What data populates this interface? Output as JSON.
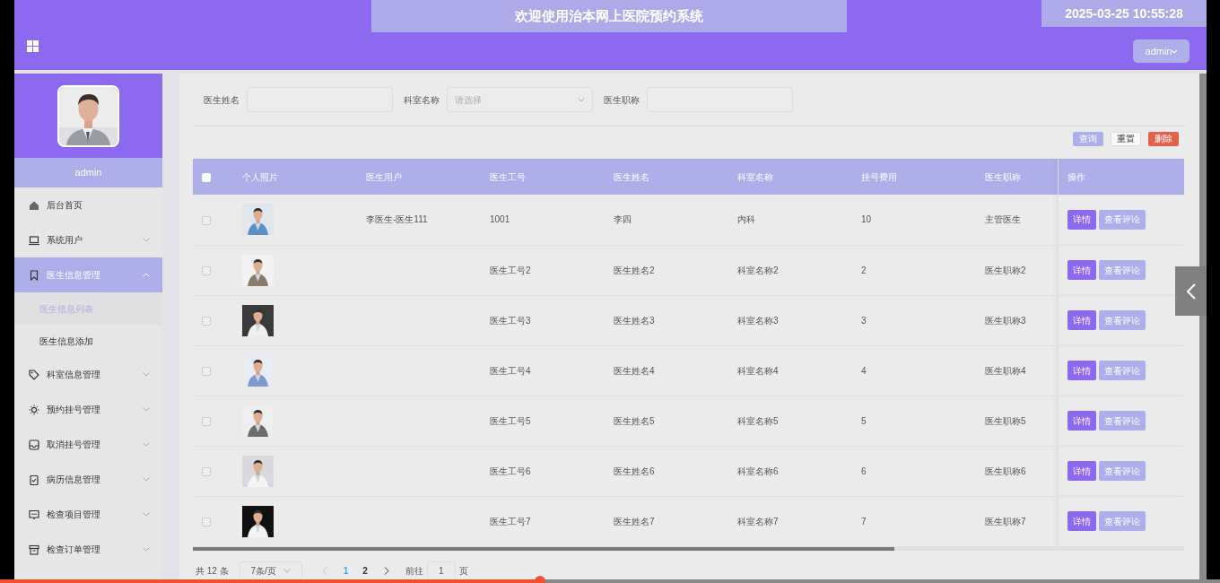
{
  "header": {
    "title": "欢迎使用治本网上医院预约系统",
    "clock": "2025-03-25 10:55:28",
    "user_button": "admin"
  },
  "sidebar": {
    "user_name": "admin",
    "items": [
      {
        "label": "后台首页",
        "expandable": false,
        "expanded": false
      },
      {
        "label": "系统用户",
        "expandable": true,
        "expanded": false
      },
      {
        "label": "医生信息管理",
        "expandable": true,
        "expanded": true,
        "children": [
          {
            "label": "医生信息列表",
            "selected": true
          },
          {
            "label": "医生信息添加",
            "selected": false
          }
        ]
      },
      {
        "label": "科室信息管理",
        "expandable": true,
        "expanded": false
      },
      {
        "label": "预约挂号管理",
        "expandable": true,
        "expanded": false
      },
      {
        "label": "取消挂号管理",
        "expandable": true,
        "expanded": false
      },
      {
        "label": "病历信息管理",
        "expandable": true,
        "expanded": false
      },
      {
        "label": "检查项目管理",
        "expandable": true,
        "expanded": false
      },
      {
        "label": "检查订单管理",
        "expandable": true,
        "expanded": false
      }
    ]
  },
  "filters": [
    {
      "label": "医生姓名",
      "kind": "text"
    },
    {
      "label": "科室名称",
      "kind": "select",
      "placeholder": "请选择"
    },
    {
      "label": "医生职称",
      "kind": "text"
    }
  ],
  "actions": [
    {
      "label": "查询",
      "kind": "primary"
    },
    {
      "label": "重置",
      "kind": "default"
    },
    {
      "label": "删除",
      "kind": "danger"
    }
  ],
  "table": {
    "select_all": false,
    "columns": [
      "个人照片",
      "医生用户",
      "医生工号",
      "医生姓名",
      "科室名称",
      "挂号费用",
      "医生职称",
      "操作"
    ],
    "rows": [
      {
        "checked": false,
        "cells": [
          "",
          "李医生-医生111",
          "1001",
          "李四",
          "内科",
          "10",
          "主管医生"
        ],
        "actions": [
          "详情",
          "查看评论"
        ]
      },
      {
        "checked": false,
        "cells": [
          "",
          "",
          "医生工号2",
          "医生姓名2",
          "科室名称2",
          "2",
          "医生职称2"
        ],
        "actions": [
          "详情",
          "查看评论"
        ]
      },
      {
        "checked": false,
        "cells": [
          "",
          "",
          "医生工号3",
          "医生姓名3",
          "科室名称3",
          "3",
          "医生职称3"
        ],
        "actions": [
          "详情",
          "查看评论"
        ]
      },
      {
        "checked": false,
        "cells": [
          "",
          "",
          "医生工号4",
          "医生姓名4",
          "科室名称4",
          "4",
          "医生职称4"
        ],
        "actions": [
          "详情",
          "查看评论"
        ]
      },
      {
        "checked": false,
        "cells": [
          "",
          "",
          "医生工号5",
          "医生姓名5",
          "科室名称5",
          "5",
          "医生职称5"
        ],
        "actions": [
          "详情",
          "查看评论"
        ]
      },
      {
        "checked": false,
        "cells": [
          "",
          "",
          "医生工号6",
          "医生姓名6",
          "科室名称6",
          "6",
          "医生职称6"
        ],
        "actions": [
          "详情",
          "查看评论"
        ]
      },
      {
        "checked": false,
        "cells": [
          "",
          "",
          "医生工号7",
          "医生姓名7",
          "科室名称7",
          "7",
          "医生职称7"
        ],
        "actions": [
          "详情",
          "查看评论"
        ]
      }
    ]
  },
  "pagination": {
    "total": "共 12 条",
    "page_size": "7条/页",
    "pages": [
      {
        "label": "1",
        "selected": true
      },
      {
        "label": "2",
        "selected": false
      }
    ],
    "goto_label": "前往",
    "goto_value": "1",
    "goto_suffix": "页"
  },
  "video_progress": {
    "level": 0.443
  }
}
